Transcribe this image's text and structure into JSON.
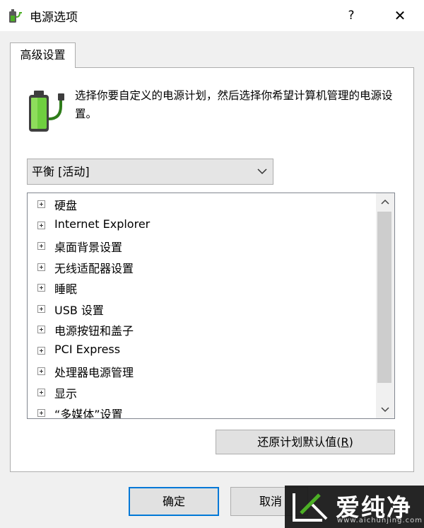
{
  "window": {
    "title": "电源选项",
    "help_label": "?",
    "close_label": "✕",
    "icon": "power-options-icon"
  },
  "tab": {
    "label": "高级设置"
  },
  "description": "选择你要自定义的电源计划，然后选择你希望计算机管理的电源设置。",
  "plan_select": {
    "value": "平衡 [活动]"
  },
  "tree": {
    "items": [
      {
        "label": "硬盘"
      },
      {
        "label": "Internet Explorer"
      },
      {
        "label": "桌面背景设置"
      },
      {
        "label": "无线适配器设置"
      },
      {
        "label": "睡眠"
      },
      {
        "label": "USB 设置"
      },
      {
        "label": "电源按钮和盖子"
      },
      {
        "label": "PCI Express"
      },
      {
        "label": "处理器电源管理"
      },
      {
        "label": "显示"
      },
      {
        "label": "“多媒体”设置"
      }
    ]
  },
  "buttons": {
    "restore_prefix": "还原计划默认值(",
    "restore_key": "R",
    "restore_suffix": ")",
    "ok": "确定",
    "cancel": "取消"
  },
  "watermark": {
    "text": "爱纯净",
    "url": "www.aichunjing.com"
  },
  "colors": {
    "accent": "#0078d7",
    "battery_green": "#4caf25"
  }
}
